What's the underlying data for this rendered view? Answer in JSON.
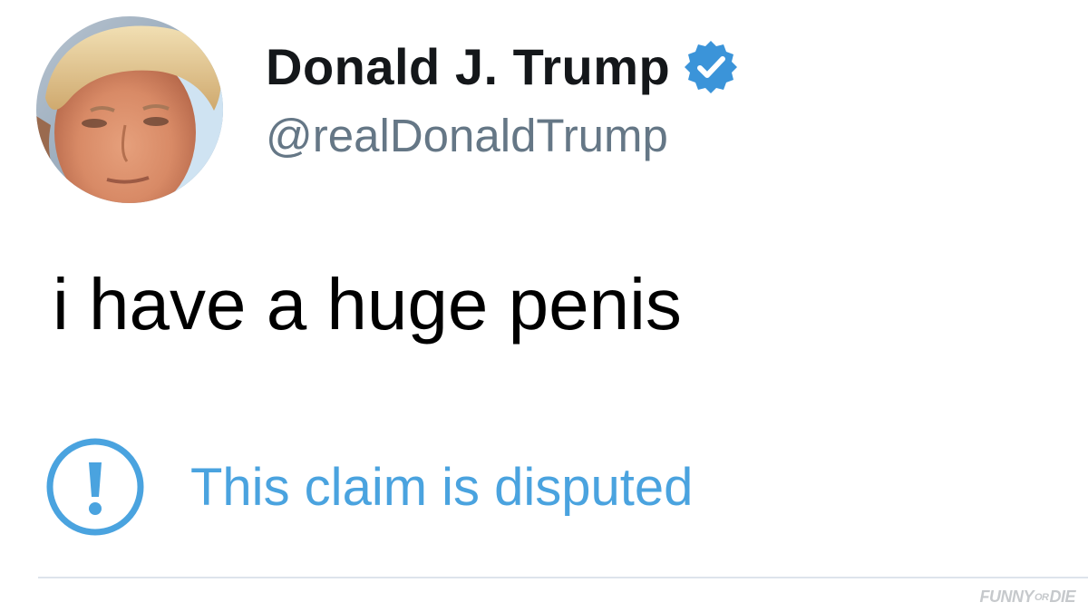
{
  "tweet": {
    "display_name": "Donald J. Trump",
    "handle": "@realDonaldTrump",
    "verified": true,
    "text": "i have a huge penis",
    "dispute_notice": "This claim is disputed"
  },
  "watermark": {
    "part1": "FUNNY",
    "amp": "OR",
    "part2": "DIE"
  },
  "colors": {
    "name": "#14171a",
    "handle": "#657786",
    "verified_blue": "#3b94d9",
    "notice_blue": "#4aa3df",
    "divider": "#dde4ec"
  },
  "icons": {
    "verified": "verified-badge-icon",
    "dispute": "exclamation-circle-icon",
    "avatar": "profile-photo"
  }
}
